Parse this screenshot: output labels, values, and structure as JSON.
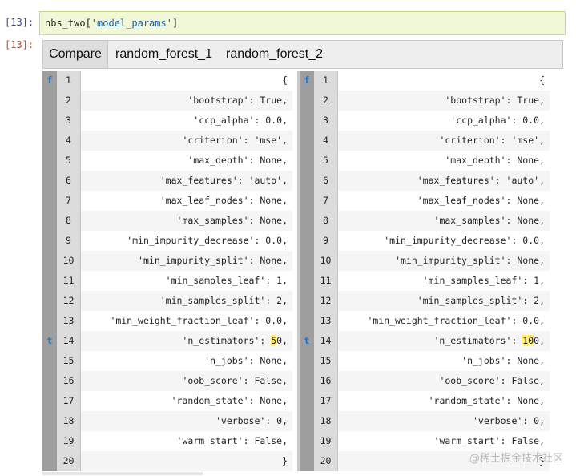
{
  "cells": {
    "input_prompt": "[13]:",
    "output_prompt": "[13]:",
    "code_prefix": "nbs_two[",
    "code_string": "'model_params'",
    "code_suffix": "]"
  },
  "tabs": [
    "Compare",
    "random_forest_1",
    "random_forest_2"
  ],
  "diff": {
    "left_lines": [
      "{",
      "'bootstrap': True,",
      "'ccp_alpha': 0.0,",
      "'criterion': 'mse',",
      "'max_depth': None,",
      "'max_features': 'auto',",
      "'max_leaf_nodes': None,",
      "'max_samples': None,",
      "'min_impurity_decrease': 0.0,",
      "'min_impurity_split': None,",
      "'min_samples_leaf': 1,",
      "'min_samples_split': 2,",
      "'min_weight_fraction_leaf': 0.0,",
      "'n_estimators': 50,",
      "'n_jobs': None,",
      "'oob_score': False,",
      "'random_state': None,",
      "'verbose': 0,",
      "'warm_start': False,",
      "}"
    ],
    "right_lines": [
      "{",
      "'bootstrap': True,",
      "'ccp_alpha': 0.0,",
      "'criterion': 'mse',",
      "'max_depth': None,",
      "'max_features': 'auto',",
      "'max_leaf_nodes': None,",
      "'max_samples': None,",
      "'min_impurity_decrease': 0.0,",
      "'min_impurity_split': None,",
      "'min_samples_leaf': 1,",
      "'min_samples_split': 2,",
      "'min_weight_fraction_leaf': 0.0,",
      "'n_estimators': 100,",
      "'n_jobs': None,",
      "'oob_score': False,",
      "'random_state': None,",
      "'verbose': 0,",
      "'warm_start': False,",
      "}"
    ],
    "markers": [
      {
        "line": 1,
        "symbol": "f"
      },
      {
        "line": 14,
        "symbol": "t"
      }
    ],
    "highlight": {
      "line": 14,
      "left_prefix": "'n_estimators': ",
      "left_changed": "5",
      "left_suffix": "0,",
      "right_prefix": "'n_estimators': ",
      "right_changed": "10",
      "right_suffix": "0,"
    }
  },
  "watermark": "@稀土掘金技术社区",
  "colors": {
    "input_bg": "#f1f8d8",
    "marker_col": "#9e9e9e",
    "gutter": "#dcdcdc",
    "highlight": "#ffef6b",
    "string": "#1a5fa8"
  }
}
